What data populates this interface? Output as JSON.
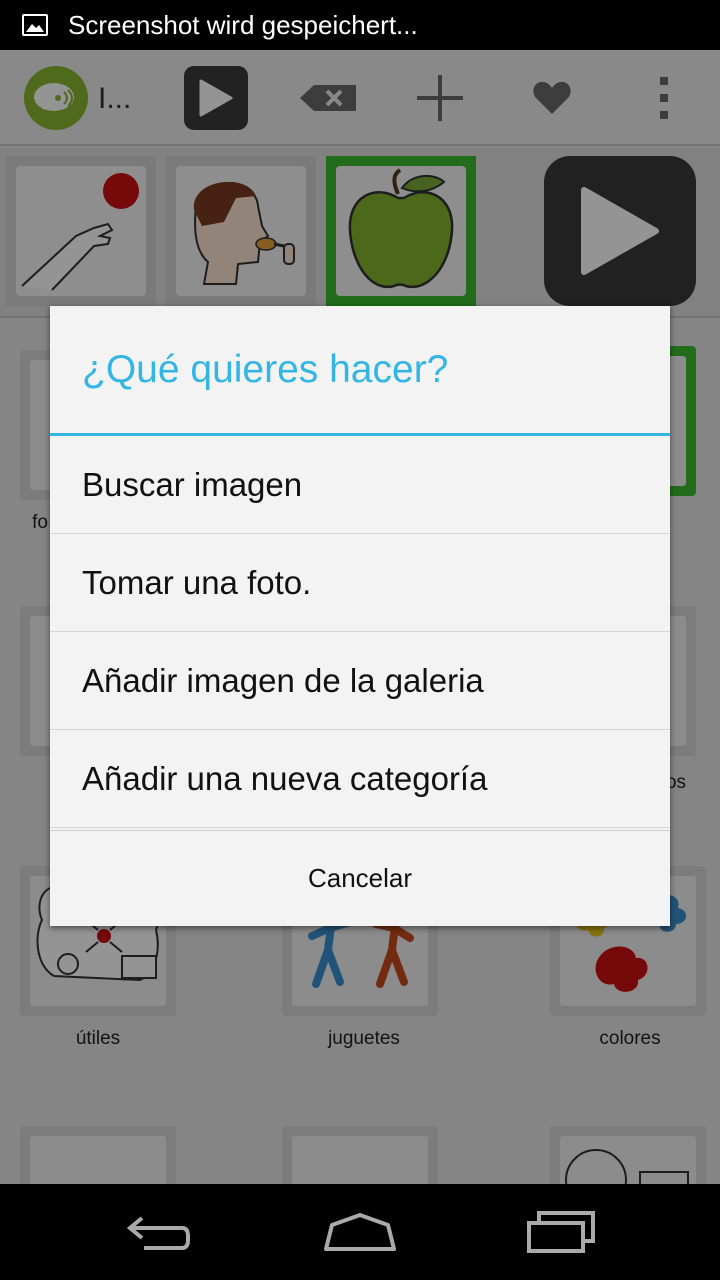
{
  "status_bar": {
    "notification_icon": "image-icon",
    "text": "Screenshot wird gespeichert..."
  },
  "action_bar": {
    "app_icon": "speech-bubble-logo",
    "title": "I...",
    "buttons": [
      "play-icon",
      "backspace-icon",
      "add-icon",
      "heart-icon",
      "overflow-menu-icon"
    ]
  },
  "sentence_strip": {
    "cards": [
      "catch-ball-pictogram",
      "eat-pictogram",
      "apple-pictogram"
    ],
    "selected_card": "apple-pictogram",
    "play_button": "play-icon"
  },
  "grid": {
    "partial_labels": [
      "fo",
      "os"
    ],
    "labels": [
      "útiles",
      "juguetes",
      "colores"
    ]
  },
  "dialog": {
    "title": "¿Qué quieres hacer?",
    "options": [
      "Buscar imagen",
      "Tomar una foto.",
      "Añadir imagen de la galeria",
      "Añadir una nueva categoría"
    ],
    "cancel": "Cancelar"
  },
  "nav_bar": {
    "buttons": [
      "back-icon",
      "home-icon",
      "recent-apps-icon"
    ]
  },
  "colors": {
    "accent": "#33b5e5",
    "selected_card": "#3bbb2f",
    "logo_green": "#8ab732"
  }
}
